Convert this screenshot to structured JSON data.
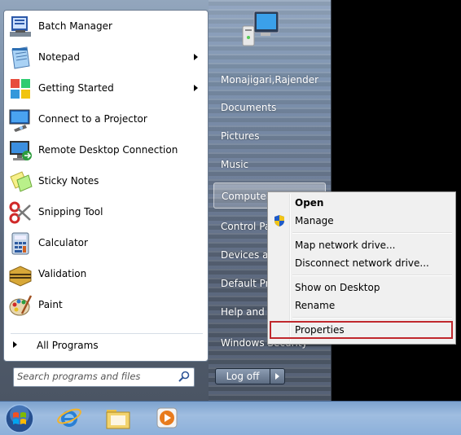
{
  "programs": [
    {
      "label": "Batch Manager",
      "icon": "batch-manager-icon",
      "submenu": false
    },
    {
      "label": "Notepad",
      "icon": "notepad-icon",
      "submenu": true
    },
    {
      "label": "Getting Started",
      "icon": "getting-started-icon",
      "submenu": true
    },
    {
      "label": "Connect to a Projector",
      "icon": "projector-icon",
      "submenu": false
    },
    {
      "label": "Remote Desktop Connection",
      "icon": "remote-desktop-icon",
      "submenu": false
    },
    {
      "label": "Sticky Notes",
      "icon": "sticky-notes-icon",
      "submenu": false
    },
    {
      "label": "Snipping Tool",
      "icon": "snipping-tool-icon",
      "submenu": false
    },
    {
      "label": "Calculator",
      "icon": "calculator-icon",
      "submenu": false
    },
    {
      "label": "Validation",
      "icon": "validation-icon",
      "submenu": false
    },
    {
      "label": "Paint",
      "icon": "paint-icon",
      "submenu": false
    }
  ],
  "all_programs_label": "All Programs",
  "search": {
    "placeholder": "Search programs and files"
  },
  "right_pane": {
    "user": "Monajigari,Rajender",
    "documents": "Documents",
    "pictures": "Pictures",
    "music": "Music",
    "computer": "Computer",
    "control_panel": "Control Pa",
    "devices": "Devices and",
    "default_programs": "Default Pro",
    "help": "Help and S",
    "security": "Windows Security"
  },
  "logoff_label": "Log off",
  "context_menu": {
    "open": "Open",
    "manage": "Manage",
    "map_drive": "Map network drive...",
    "disconnect_drive": "Disconnect network drive...",
    "show_desktop": "Show on Desktop",
    "rename": "Rename",
    "properties": "Properties"
  },
  "colors": {
    "highlight_border": "#c0282d",
    "taskbar": "#8cb0da"
  }
}
